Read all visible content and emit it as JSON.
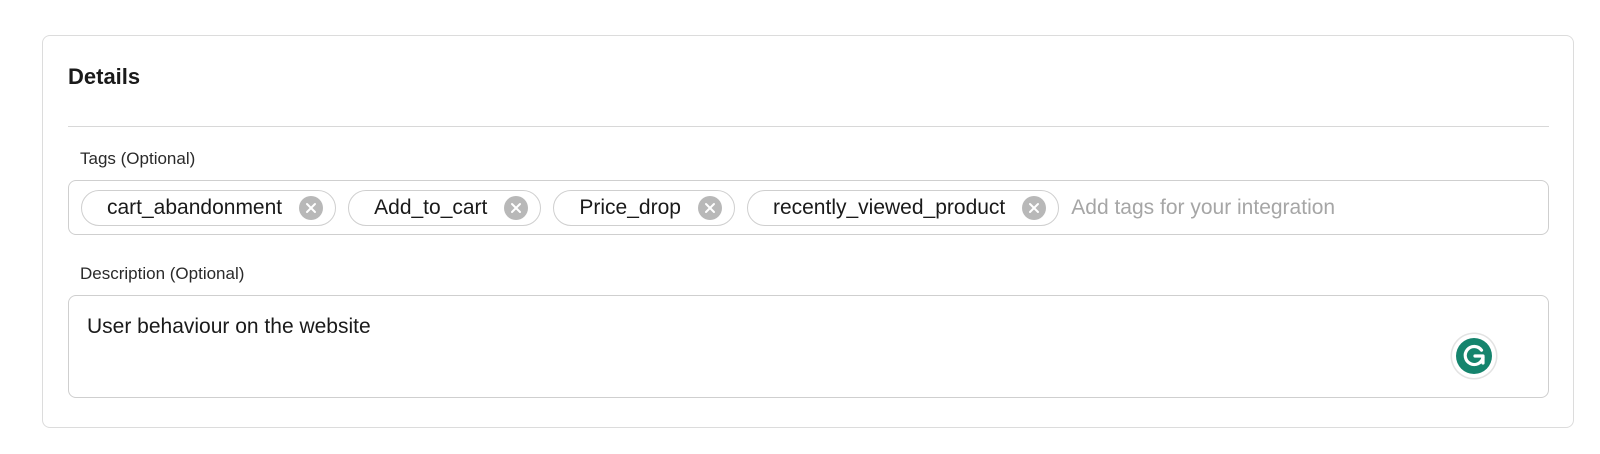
{
  "section": {
    "title": "Details"
  },
  "tags": {
    "label": "Tags (Optional)",
    "items": [
      {
        "label": "cart_abandonment"
      },
      {
        "label": "Add_to_cart"
      },
      {
        "label": "Price_drop"
      },
      {
        "label": "recently_viewed_product"
      }
    ],
    "placeholder": "Add tags for your integration",
    "remove_icon": "close-circle-icon"
  },
  "description": {
    "label": "Description (Optional)",
    "value": "User behaviour on the website"
  },
  "grammarly": {
    "icon": "grammarly-icon",
    "color": "#15846d"
  }
}
